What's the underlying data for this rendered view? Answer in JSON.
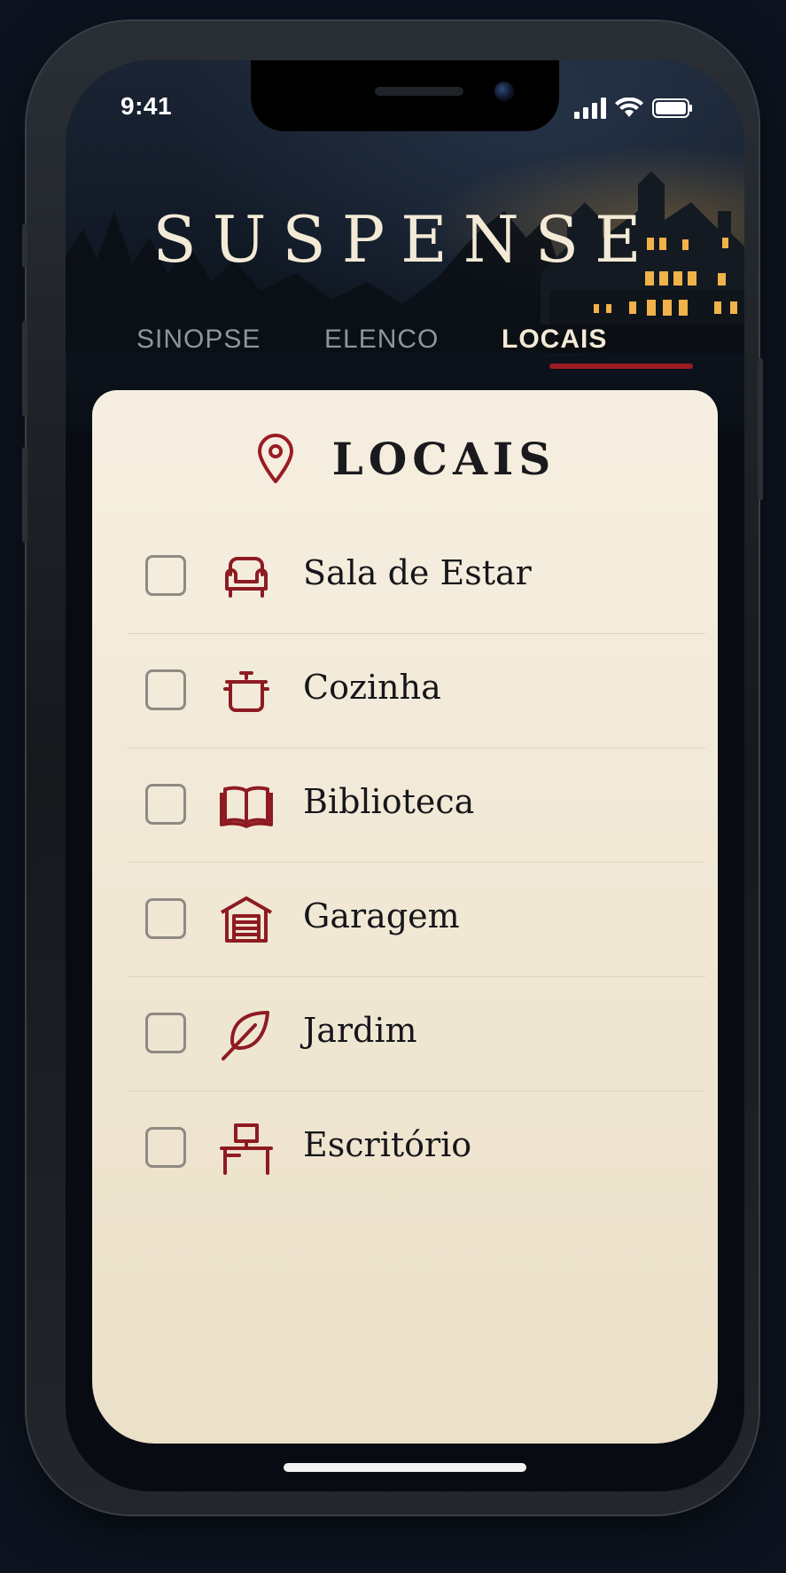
{
  "status_bar": {
    "time": "9:41"
  },
  "app": {
    "title": "SUSPENSE"
  },
  "tabs": [
    {
      "label": "SINOPSE",
      "active": false
    },
    {
      "label": "ELENCO",
      "active": false
    },
    {
      "label": "LOCAIS",
      "active": true
    }
  ],
  "section": {
    "title": "LOCAIS",
    "icon": "map-pin-icon"
  },
  "locations": [
    {
      "label": "Sala de Estar",
      "icon": "armchair-icon",
      "checked": false
    },
    {
      "label": "Cozinha",
      "icon": "cooking-pot-icon",
      "checked": false
    },
    {
      "label": "Biblioteca",
      "icon": "open-book-icon",
      "checked": false
    },
    {
      "label": "Garagem",
      "icon": "garage-icon",
      "checked": false
    },
    {
      "label": "Jardim",
      "icon": "leaf-icon",
      "checked": false
    },
    {
      "label": "Escritório",
      "icon": "desk-icon",
      "checked": false
    }
  ],
  "colors": {
    "accent": "#9b1c24",
    "card_background": "#f3ebda",
    "screen_background": "#080c12",
    "title_text": "#f3ead6",
    "inactive_tab": "#8f959f"
  }
}
